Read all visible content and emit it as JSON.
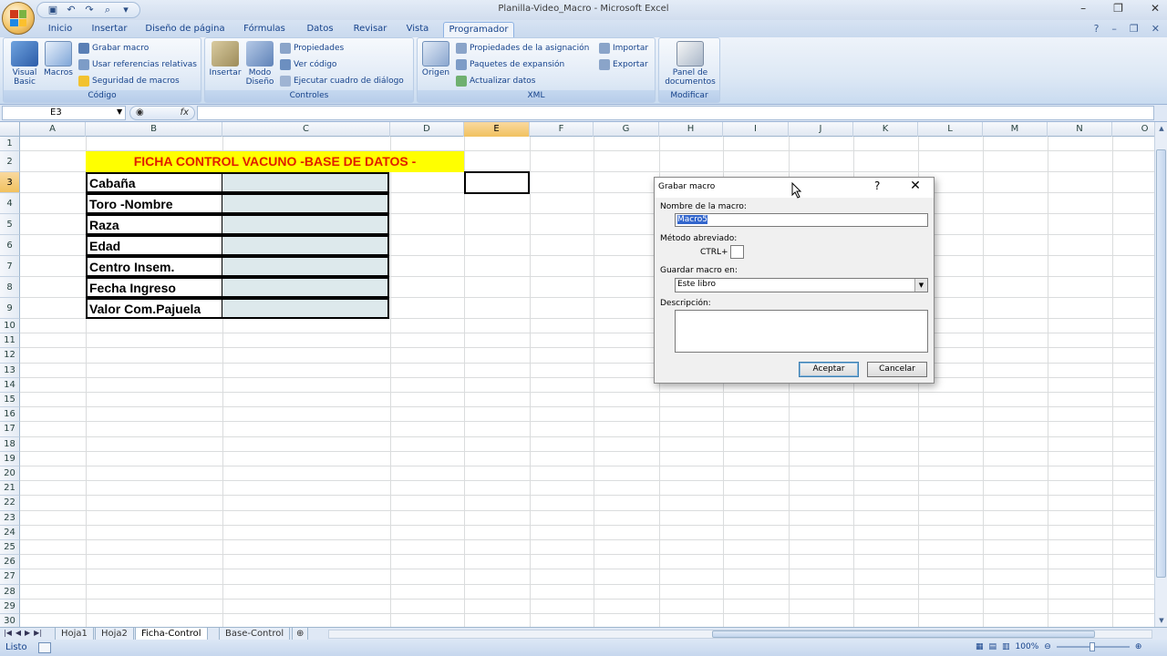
{
  "window": {
    "title": "Planilla-Video_Macro - Microsoft Excel"
  },
  "tabs": [
    "Inicio",
    "Insertar",
    "Diseño de página",
    "Fórmulas",
    "Datos",
    "Revisar",
    "Vista",
    "Programador"
  ],
  "active_tab": "Programador",
  "ribbon": {
    "codigo": {
      "label": "Código",
      "visual_basic": "Visual\nBasic",
      "macros": "Macros",
      "grabar_macro": "Grabar macro",
      "usar_referencias": "Usar referencias relativas",
      "seguridad": "Seguridad de macros"
    },
    "controles": {
      "label": "Controles",
      "insertar": "Insertar",
      "modo_diseno": "Modo\nDiseño",
      "propiedades": "Propiedades",
      "ver_codigo": "Ver código",
      "ejecutar_dialogo": "Ejecutar cuadro de diálogo"
    },
    "xml": {
      "label": "XML",
      "origen": "Origen",
      "propiedades_asignacion": "Propiedades de la asignación",
      "paquetes": "Paquetes de expansión",
      "actualizar": "Actualizar datos",
      "importar": "Importar",
      "exportar": "Exportar"
    },
    "modificar": {
      "label": "Modificar",
      "panel": "Panel de\ndocumentos"
    }
  },
  "formula_bar": {
    "name_box": "E3",
    "fx": "fx",
    "value": ""
  },
  "columns": [
    "A",
    "B",
    "C",
    "D",
    "E",
    "F",
    "G",
    "H",
    "I",
    "J",
    "K",
    "L",
    "M",
    "N",
    "O"
  ],
  "selected_column": "E",
  "rows": [
    "1",
    "2",
    "3",
    "4",
    "5",
    "6",
    "7",
    "8",
    "9",
    "10",
    "11",
    "12",
    "13",
    "14",
    "15",
    "16",
    "17",
    "18",
    "19",
    "20",
    "21",
    "22",
    "23",
    "24",
    "25",
    "26",
    "27",
    "28",
    "29",
    "30"
  ],
  "selected_row": "3",
  "sheet": {
    "title": "FICHA CONTROL VACUNO -BASE DE DATOS -",
    "fields": [
      "Cabaña",
      "Toro -Nombre",
      "Raza",
      "Edad",
      "Centro Insem.",
      "Fecha Ingreso",
      "Valor Com.Pajuela"
    ]
  },
  "sheet_tabs": [
    "Hoja1",
    "Hoja2",
    "Ficha-Control",
    "Base-Control"
  ],
  "active_sheet": "Ficha-Control",
  "status": {
    "text": "Listo",
    "zoom": "100%"
  },
  "dialog": {
    "title": "Grabar macro",
    "help": "?",
    "close": "✕",
    "name_label": "Nombre de la macro:",
    "name_value": "Macro5",
    "shortcut_label": "Método abreviado:",
    "shortcut_prefix": "CTRL+",
    "shortcut_value": "",
    "store_label": "Guardar macro en:",
    "store_value": "Este libro",
    "desc_label": "Descripción:",
    "desc_value": "",
    "ok": "Aceptar",
    "cancel": "Cancelar"
  },
  "colors": {
    "title_fill": "#ffff00",
    "title_text": "#e01e00",
    "value_cell": "#dde9ec",
    "selection": "#f1c15f"
  }
}
